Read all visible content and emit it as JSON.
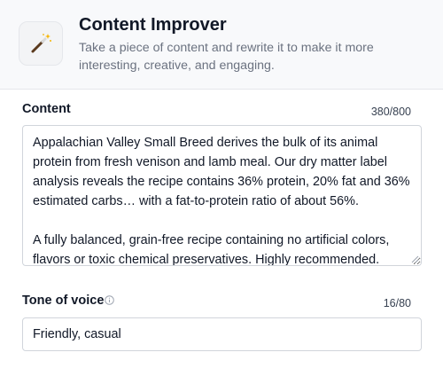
{
  "header": {
    "icon": "magic-wand-icon",
    "title": "Content Improver",
    "subtitle": "Take a piece of content and rewrite it to make it more interesting, creative, and engaging."
  },
  "content_field": {
    "label": "Content",
    "counter": "380/800",
    "value": "Appalachian Valley Small Breed derives the bulk of its animal protein from fresh venison and lamb meal. Our dry matter label analysis reveals the recipe contains 36% protein, 20% fat and 36% estimated carbs… with a fat-to-protein ratio of about 56%.\n\nA fully balanced, grain-free recipe containing no artificial colors, flavors or toxic chemical preservatives. Highly recommended."
  },
  "tone_field": {
    "label": "Tone of voice",
    "info_icon": "info-icon",
    "counter": "16/80",
    "value": "Friendly, casual"
  }
}
